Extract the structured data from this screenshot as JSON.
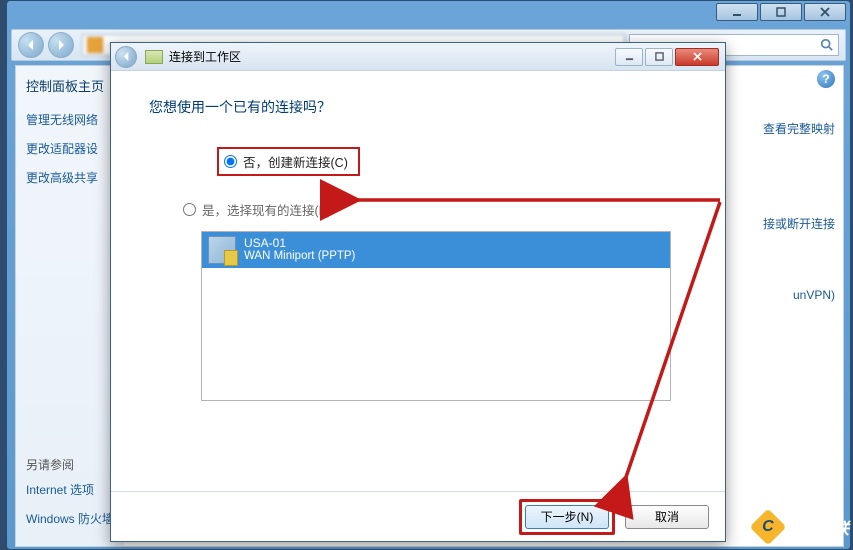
{
  "outer": {
    "sidebar_header": "控制面板主页",
    "link_wireless": "管理无线网络",
    "link_adapter": "更改适配器设",
    "link_share": "更改高级共享",
    "see_also": "另请参阅",
    "internet_opts": "Internet 选项",
    "firewall": "Windows 防火墙"
  },
  "right_links": {
    "full_map": "查看完整映射",
    "conn_or_disc": "接或断开连接",
    "unvpn": "unVPN)"
  },
  "wizard": {
    "title": "连接到工作区",
    "heading": "您想使用一个已有的连接吗？",
    "radio_no": "否，创建新连接(C)",
    "radio_yes": "是，选择现有的连接(E)",
    "item_name": "USA-01",
    "item_proto": "WAN Miniport (PPTP)",
    "next": "下一步(N)",
    "cancel": "取消"
  },
  "watermark": "创新互联"
}
